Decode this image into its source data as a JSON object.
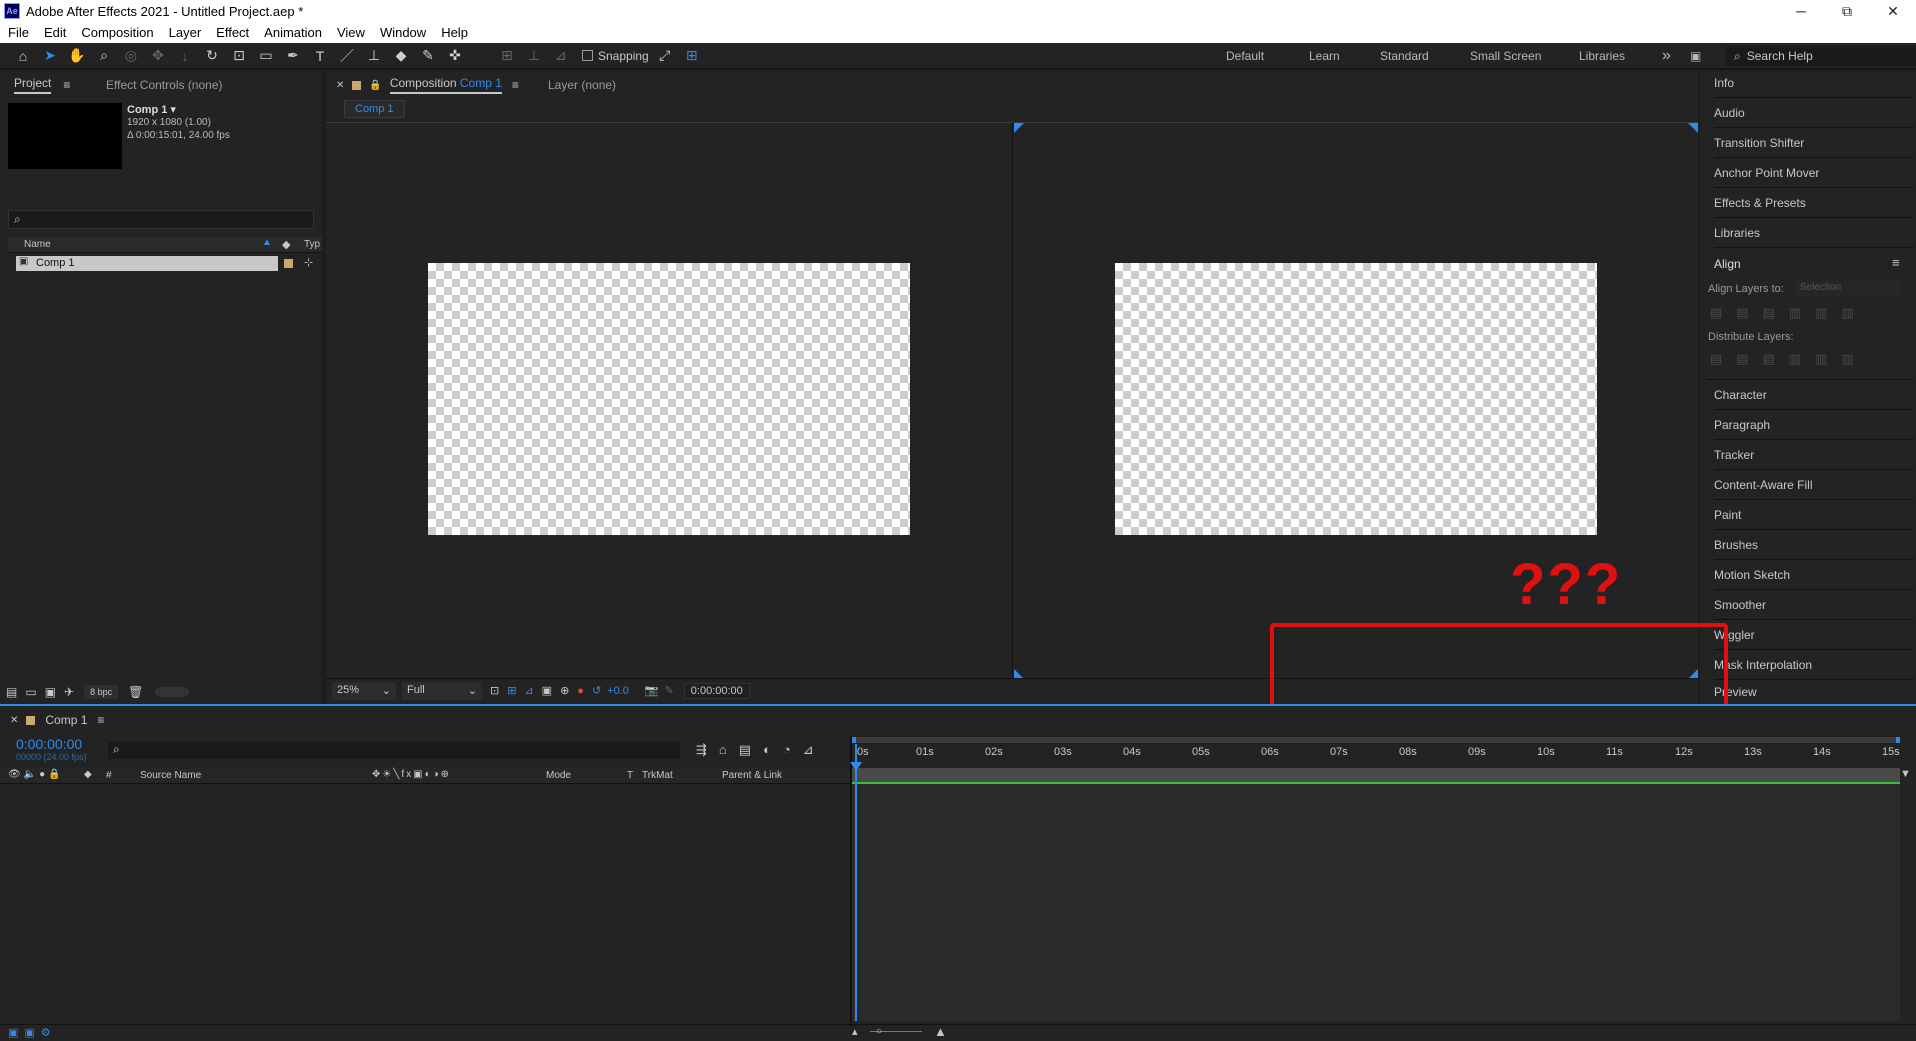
{
  "window": {
    "app_icon": "Ae",
    "title": "Adobe After Effects 2021 - Untitled Project.aep *",
    "minimize": "─",
    "maximize": "⧉",
    "close": "✕"
  },
  "menu": [
    "File",
    "Edit",
    "Composition",
    "Layer",
    "Effect",
    "Animation",
    "View",
    "Window",
    "Help"
  ],
  "toolbar": {
    "snapping_label": "Snapping",
    "workspaces": [
      "Default",
      "Learn",
      "Standard",
      "Small Screen",
      "Libraries"
    ],
    "more": "»",
    "search_help_placeholder": "Search Help"
  },
  "project_panel": {
    "tab_project": "Project",
    "tab_effect_controls": "Effect Controls (none)",
    "comp_name": "Comp 1 ▾",
    "comp_size": "1920 x 1080 (1.00)",
    "comp_duration": "Δ 0:00:15:01, 24.00 fps",
    "search_placeholder": "",
    "col_name": "Name",
    "col_type": "Typ",
    "items": [
      {
        "name": "Comp 1"
      }
    ],
    "bpc": "8 bpc"
  },
  "comp_panel": {
    "tab_label": "Composition",
    "tab_comp_name": "Comp 1",
    "layer_tab": "Layer (none)",
    "flow_tab": "Comp 1",
    "zoom": "25%",
    "resolution": "Full",
    "exposure": "+0.0",
    "timecode": "0:00:00:00"
  },
  "annotation": {
    "question_marks": "???",
    "color": "#e01010"
  },
  "right_panels": {
    "items": [
      "Info",
      "Audio",
      "Transition Shifter",
      "Anchor Point Mover",
      "Effects & Presets",
      "Libraries"
    ],
    "align": {
      "title": "Align",
      "align_layers_to": "Align Layers to:",
      "selection": "Selection",
      "distribute_layers": "Distribute Layers:"
    },
    "items_after": [
      "Character",
      "Paragraph",
      "Tracker",
      "Content-Aware Fill",
      "Paint",
      "Brushes",
      "Motion Sketch",
      "Smoother",
      "Wiggler",
      "Mask Interpolation",
      "Preview"
    ]
  },
  "timeline": {
    "tab_label": "Comp 1",
    "timecode": "0:00:00:00",
    "frame_info": "00000 (24.00 fps)",
    "col_source_name": "Source Name",
    "col_mode": "Mode",
    "col_t": "T",
    "col_trkmat": "TrkMat",
    "col_parent": "Parent & Link",
    "col_hash": "#",
    "ruler": [
      "0s",
      "01s",
      "02s",
      "03s",
      "04s",
      "05s",
      "06s",
      "07s",
      "08s",
      "09s",
      "10s",
      "11s",
      "12s",
      "13s",
      "14s",
      "15s"
    ]
  },
  "colors": {
    "accent": "#2d8ceb",
    "annotation_red": "#e01010",
    "work_area_green": "#3bbd3b"
  }
}
